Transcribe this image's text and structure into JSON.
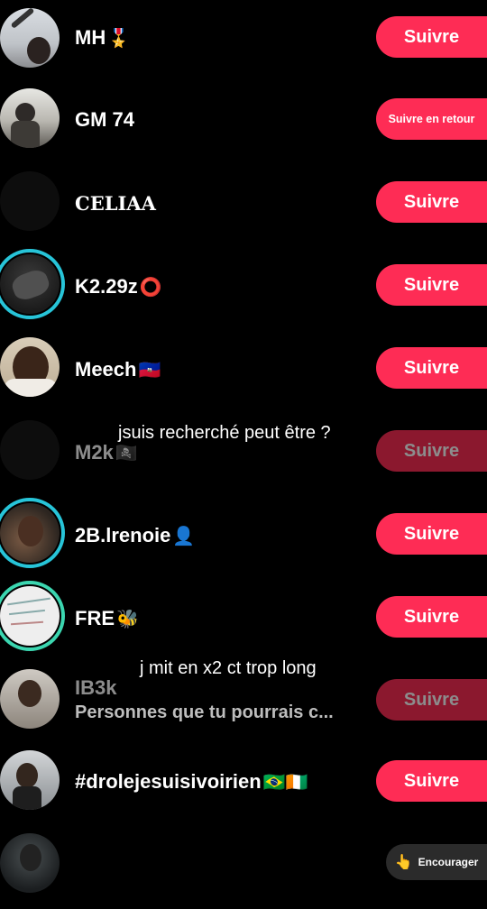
{
  "rows": [
    {
      "name": "MH",
      "emoji": "🎖️",
      "button": "Suivre"
    },
    {
      "name": "GM 74",
      "emoji": "",
      "button": "Suivre en retour"
    },
    {
      "name": "CELIAA",
      "emoji": "",
      "button": "Suivre"
    },
    {
      "name": "K2.29z",
      "emoji": "⭕",
      "button": "Suivre"
    },
    {
      "name": "Meech",
      "emoji": "🇭🇹",
      "button": "Suivre"
    },
    {
      "name": "M2k",
      "emoji": "🏴‍☠️",
      "button": "Suivre"
    },
    {
      "name": "2B.lrenoie",
      "emoji": "👤",
      "button": "Suivre"
    },
    {
      "name": "FRE",
      "emoji": "🐝",
      "button": "Suivre"
    },
    {
      "name": "IB3k",
      "subtitle": "Personnes que tu pourrais c...",
      "button": "Suivre"
    },
    {
      "name": "#drolejesuisivoirien",
      "emoji": "🇧🇷🇨🇮",
      "button": "Suivre"
    },
    {
      "button": "Encourager",
      "button_icon": "👆"
    }
  ],
  "captions": {
    "first": "jsuis recherché peut être ?",
    "second": "j mit en x2 ct trop long"
  },
  "colors": {
    "background": "#000000",
    "follow_button": "#fe2c55",
    "story_ring": "#27c4d8"
  }
}
